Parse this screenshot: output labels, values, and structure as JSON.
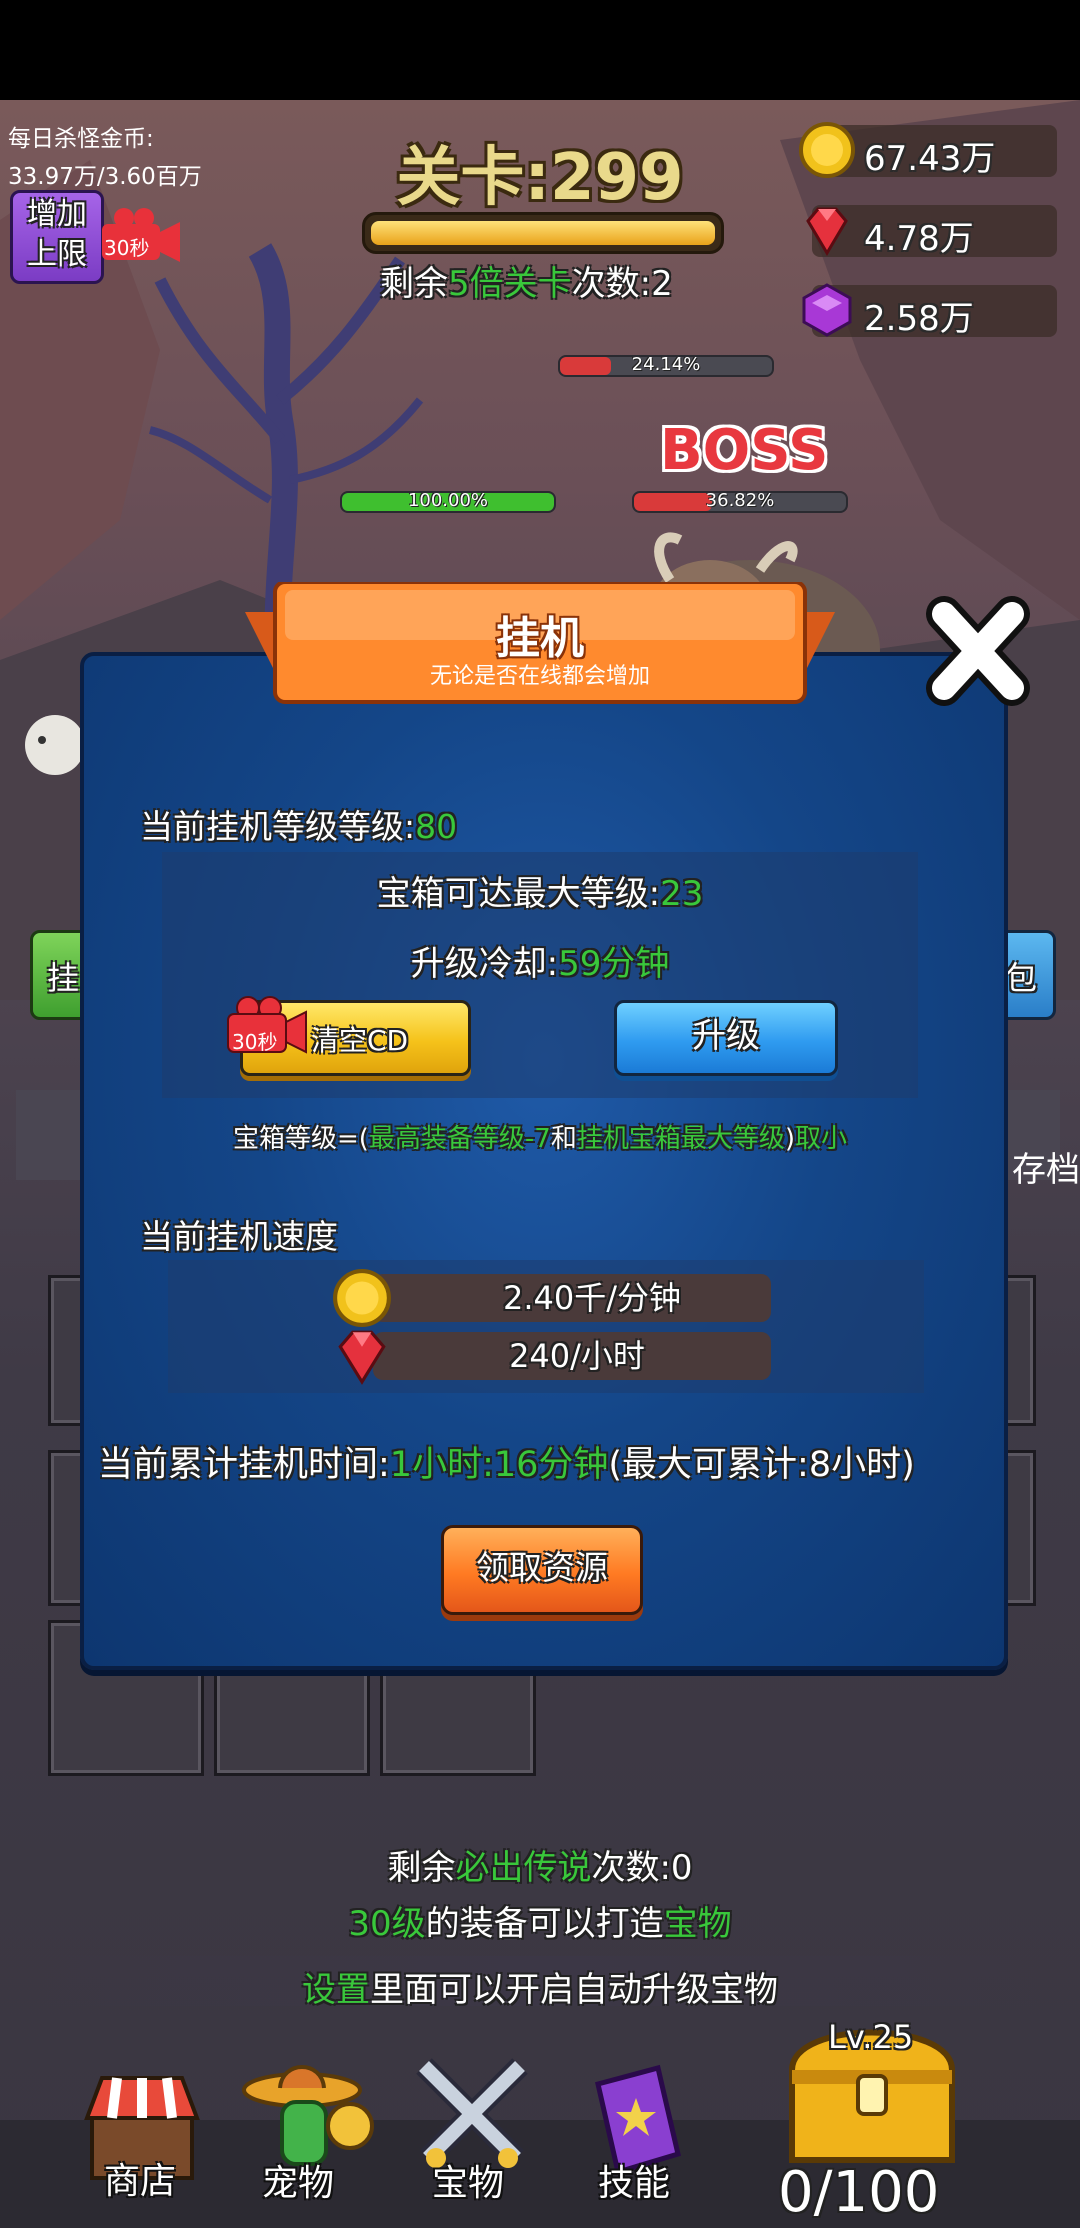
{
  "hud": {
    "daily_kill_label": "每日杀怪金币:",
    "daily_kill_value": "33.97万/3.60百万",
    "increase_limit_line1": "增加",
    "increase_limit_line2": "上限",
    "ad_timer_small": "30秒",
    "stage_title": "关卡:299",
    "remaining_prefix": "剩余",
    "remaining_highlight": "5倍关卡",
    "remaining_suffix": "次数:2",
    "gold": "67.43万",
    "ruby": "4.78万",
    "gem": "2.58万"
  },
  "battle": {
    "boss_label": "BOSS",
    "bar_top_pct": "24.14%",
    "bar_player_pct": "100.00%",
    "bar_boss_pct": "36.82%",
    "bar_top_fill": 0.2414,
    "bar_player_fill": 1.0,
    "bar_boss_fill": 0.3682
  },
  "side": {
    "left_tab_partial": "挂",
    "right_tab_partial": "包",
    "right_label_partial": "存档"
  },
  "modal": {
    "title": "挂机",
    "subtitle": "无论是否在线都会增加",
    "level_label": "当前挂机等级等级:",
    "level_value": "80",
    "chest_max_label": "宝箱可达最大等级:",
    "chest_max_value": "23",
    "cooldown_label": "升级冷却:",
    "cooldown_value": "59分钟",
    "clear_cd_timer": "30秒",
    "clear_cd_label": "清空CD",
    "upgrade_label": "升级",
    "formula_prefix": "宝箱等级=(",
    "formula_part1": "最高装备等级-7",
    "formula_and": "和",
    "formula_part2": "挂机宝箱最大等级",
    "formula_suffix1": ")",
    "formula_suffix2": "取小",
    "speed_label": "当前挂机速度",
    "gold_rate": "2.40千/分钟",
    "ruby_rate": "240/小时",
    "accum_label": "当前累计挂机时间:",
    "accum_value": "1小时:16分钟",
    "accum_max": "(最大可累计:8小时)",
    "claim_label": "领取资源"
  },
  "tips": {
    "line1_prefix": "剩余",
    "line1_highlight": "必出传说",
    "line1_suffix": "次数:0",
    "line2_highlight1": "30级",
    "line2_mid": "的装备可以打造",
    "line2_highlight2": "宝物",
    "line3_highlight": "设置",
    "line3_suffix": "里面可以开启自动升级宝物"
  },
  "nav": {
    "shop": "商店",
    "pet": "宠物",
    "treasure": "宝物",
    "skill": "技能",
    "chest_level": "Lv.25",
    "chest_count": "0/100"
  },
  "colors": {
    "highlight_green": "#39c83b",
    "modal_blue": "#144688",
    "banner_orange": "#ff7a22"
  }
}
